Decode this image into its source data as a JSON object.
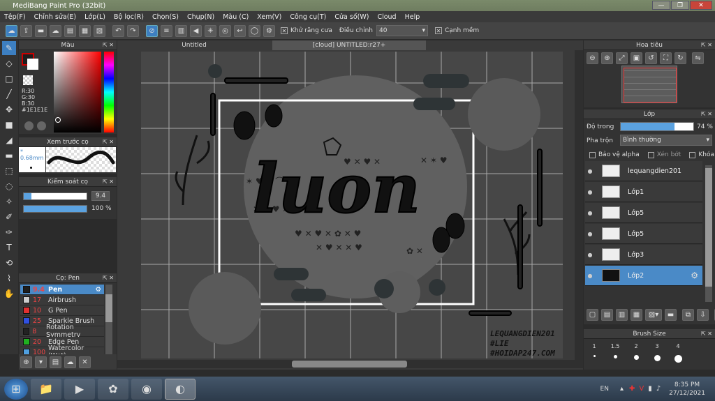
{
  "window": {
    "title": "MediBang Paint Pro (32bit)"
  },
  "menu": [
    "Tệp(F)",
    "Chỉnh sửa(E)",
    "Lớp(L)",
    "Bộ lọc(R)",
    "Chọn(S)",
    "Chụp(N)",
    "Màu (C)",
    "Xem(V)",
    "Công cụ(T)",
    "Cửa số(W)",
    "Cloud",
    "Help"
  ],
  "toolbar": {
    "antialias_label": "Khử răng cưa",
    "adjust_label": "Điều chỉnh",
    "adjust_value": "40",
    "edge_label": "Cạnh mềm"
  },
  "color": {
    "title": "Màu",
    "r": "R:30",
    "g": "G:30",
    "b": "B:30",
    "hex": "#1E1E1E",
    "fg": "#1e1e1e",
    "accent": "#cc0000"
  },
  "preview": {
    "title": "Xem trước cọ",
    "size": "0.68mm"
  },
  "brush_control": {
    "title": "Kiểm soát cọ",
    "size_value": "9.4",
    "opacity_value": "100 %",
    "size_fill": 0.12,
    "opacity_fill": 1.0
  },
  "pen_panel": {
    "title": "Cọ: Pen",
    "items": [
      {
        "size": "9.4",
        "name": "Pen",
        "color": "#1e1e1e",
        "selected": true
      },
      {
        "size": "17",
        "name": "Airbrush",
        "color": "#cccccc",
        "selected": false
      },
      {
        "size": "10",
        "name": "G Pen",
        "color": "#e03030",
        "selected": false
      },
      {
        "size": "25",
        "name": "Sparkle Brush",
        "color": "#3050e0",
        "selected": false
      },
      {
        "size": "8",
        "name": "Rotation Symmetry",
        "color": "#222222",
        "selected": false
      },
      {
        "size": "20",
        "name": "Edge Pen",
        "color": "#20b020",
        "selected": false
      },
      {
        "size": "100",
        "name": "Watercolor (Wet)",
        "color": "#50a0e0",
        "selected": false
      }
    ]
  },
  "tabs": {
    "tab1": "Untitled",
    "tab2": "[cloud] UNTITLED:r27+"
  },
  "canvas": {
    "art_text": "luon",
    "watermark": [
      "LEQUANGDIEN201",
      "#LIE",
      "#HOIDAP247.COM"
    ]
  },
  "navigator": {
    "title": "Hoa tiêu"
  },
  "layers": {
    "title": "Lớp",
    "opacity_label": "Độ trong",
    "opacity_value": "74 %",
    "opacity_fill": 0.74,
    "blend_label": "Pha trộn",
    "blend_value": "Bình thường",
    "protect_alpha": "Bảo vệ alpha",
    "clip": "Xén bớt",
    "lock": "Khóa",
    "items": [
      {
        "name": "lequangdien201",
        "selected": false
      },
      {
        "name": "Lớp1",
        "selected": false
      },
      {
        "name": "Lớp5",
        "selected": false
      },
      {
        "name": "Lớp5",
        "selected": false
      },
      {
        "name": "Lớp3",
        "selected": false
      },
      {
        "name": "Lớp2",
        "selected": true
      }
    ]
  },
  "brush_size": {
    "title": "Brush Size",
    "sizes": [
      "1",
      "1.5",
      "2",
      "3",
      "4"
    ]
  },
  "taskbar": {
    "lang": "EN",
    "time": "8:35 PM",
    "date": "27/12/2021"
  }
}
